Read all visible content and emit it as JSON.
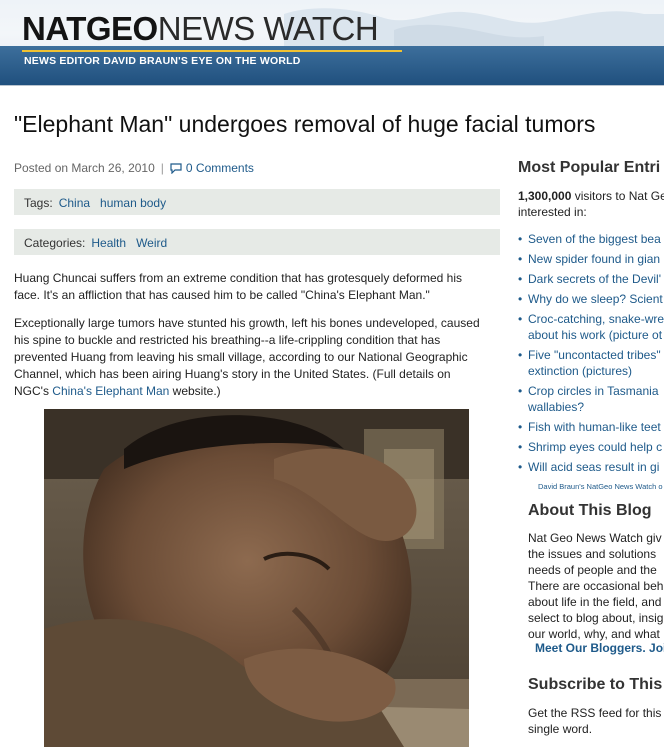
{
  "header": {
    "brand_bold": "NATGEO",
    "brand_light": "NEWS WATCH",
    "tagline": "NEWS EDITOR DAVID BRAUN'S EYE ON THE WORLD"
  },
  "article": {
    "title": "\"Elephant Man\" undergoes removal of huge facial tumors",
    "posted": "Posted on March 26, 2010",
    "separator": "|",
    "comments": "0 Comments",
    "tags_label": "Tags:",
    "tags": [
      "China",
      "human body"
    ],
    "categories_label": "Categories:",
    "categories": [
      "Health",
      "Weird"
    ],
    "paragraph1_lines": [
      "Huang Chuncai suffers from an extreme condition that has grotesquely deformed his",
      "face. It's an affliction that has caused him to be called \"China's Elephant Man.\""
    ],
    "paragraph2_lines": [
      "Exceptionally large tumors have stunted his growth, left his bones undeveloped, caused",
      "his spine to buckle and restricted his breathing--a life-crippling condition that has",
      "prevented Huang from leaving his small village, according to our National Geographic",
      "Channel, which has been airing Huang's story in the United States. (Full details on"
    ],
    "paragraph2_last_prefix": "NGC's ",
    "paragraph2_link": "China's Elephant Man",
    "paragraph2_last_suffix": " website.)"
  },
  "sidebar": {
    "popular_heading": "Most Popular Entri",
    "visitors_count": "1,300,000",
    "visitors_text": " visitors to Nat Ge",
    "visitors_text2": "interested in:",
    "popular_items": [
      "Seven of the biggest bea",
      "New spider found in gian",
      "Dark secrets of the Devil'",
      "Why do we sleep? Scient",
      "Croc-catching, snake-wre",
      "about his work (picture ot",
      "Five \"uncontacted tribes\"",
      "extinction (pictures)",
      "Crop circles in Tasmania",
      "wallabies?",
      "Fish with human-like teet",
      "Shrimp eyes could help c",
      "Will acid seas result in gi"
    ],
    "tiny_credit": "David Braun's NatGeo News Watch o",
    "about_heading": "About This Blog",
    "about_lines": [
      "Nat Geo News Watch giv",
      "the issues and solutions",
      "needs of people and the",
      "There are occasional beh",
      "about life in the field, and",
      "select to blog about, insig",
      "our world, why, and what"
    ],
    "bloggers_link": "Meet Our Bloggers. Joi",
    "subscribe_heading": "Subscribe to This",
    "subscribe_lines": [
      "Get the RSS feed for this",
      "single word."
    ]
  },
  "colors": {
    "link": "#1e5a8a",
    "header_bar": "#1f4f7d",
    "tag_box": "#e6eae6"
  }
}
